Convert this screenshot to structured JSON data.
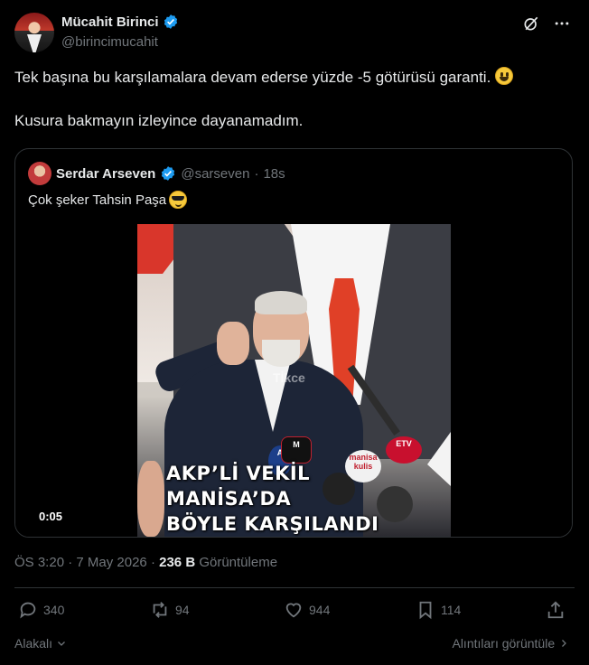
{
  "author": {
    "name": "Mücahit Birinci",
    "handle": "@birincimucahit",
    "verified": true
  },
  "header_icons": [
    "grok-icon",
    "more-icon"
  ],
  "tweet": {
    "line1": "Tek başına bu karşılamalara devam ederse yüzde -5 götürüsü garanti.",
    "line1_emoji": "grinning-face-emoji",
    "line2": "Kusura bakmayın izleyince dayanamadım."
  },
  "quoted": {
    "name": "Serdar Arseven",
    "handle": "@sarseven",
    "separator": "·",
    "time": "18s",
    "text": "Çok şeker Tahsin Paşa",
    "text_emoji": "sunglasses-emoji",
    "video": {
      "overlay_lines": [
        "AKP’Lİ VEKİL",
        "MANİSA’DA",
        "BÖYLE KARŞILANDI"
      ],
      "watermark": "Tİkce",
      "duration": "0:05",
      "mic_labels": [
        "A",
        "M",
        "manisa kulis",
        "ETV"
      ]
    }
  },
  "meta": {
    "time": "ÖS 3:20",
    "sep1": "·",
    "date": "7 May 2026",
    "sep2": "·",
    "views": "236 B",
    "views_label": "Görüntüleme"
  },
  "actions": {
    "replies": "340",
    "reposts": "94",
    "likes": "944",
    "bookmarks": "114"
  },
  "footer": {
    "left": "Alakalı",
    "right": "Alıntıları görüntüle"
  },
  "colors": {
    "background": "#000000",
    "text": "#e7e9ea",
    "muted": "#71767b",
    "verified": "#1d9bf0",
    "border": "#2f3336"
  }
}
